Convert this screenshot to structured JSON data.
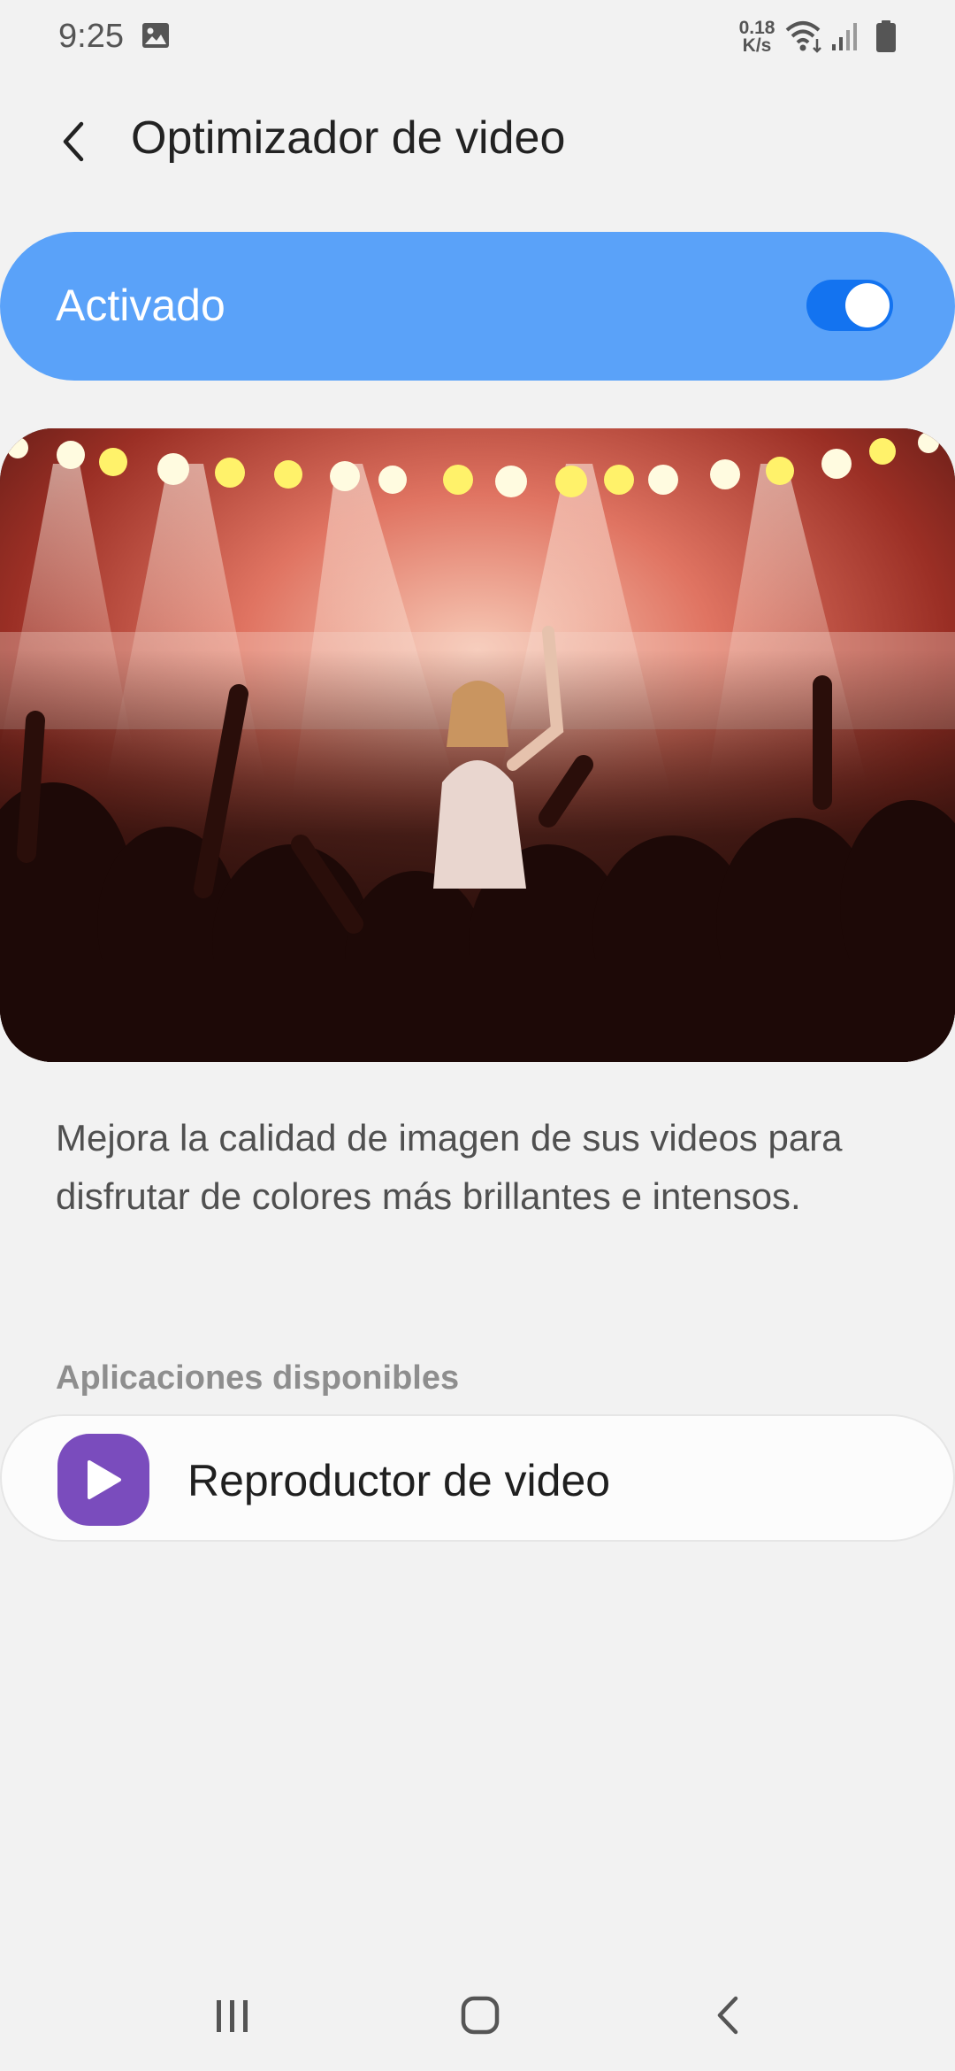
{
  "status_bar": {
    "time": "9:25",
    "net_speed_value": "0.18",
    "net_speed_unit": "K/s",
    "icons": [
      "gallery-icon",
      "wifi-icon",
      "signal-icon",
      "battery-icon"
    ]
  },
  "header": {
    "title": "Optimizador de video",
    "back_icon": "chevron-left-icon"
  },
  "master_toggle": {
    "label": "Activado",
    "state": "on",
    "card_color": "#5aa2f9",
    "switch_color": "#1373f0"
  },
  "hero_image": {
    "subject": "concert-crowd-photo"
  },
  "description": "Mejora la calidad de imagen de sus videos para disfrutar de colores más brillantes e intensos.",
  "available_apps": {
    "section_title": "Aplicaciones disponibles",
    "items": [
      {
        "label": "Reproductor de video",
        "icon": "play-icon",
        "icon_color": "#7a4cbd"
      }
    ]
  },
  "nav_bar": {
    "icons": [
      "recents-icon",
      "home-icon",
      "back-icon"
    ]
  }
}
